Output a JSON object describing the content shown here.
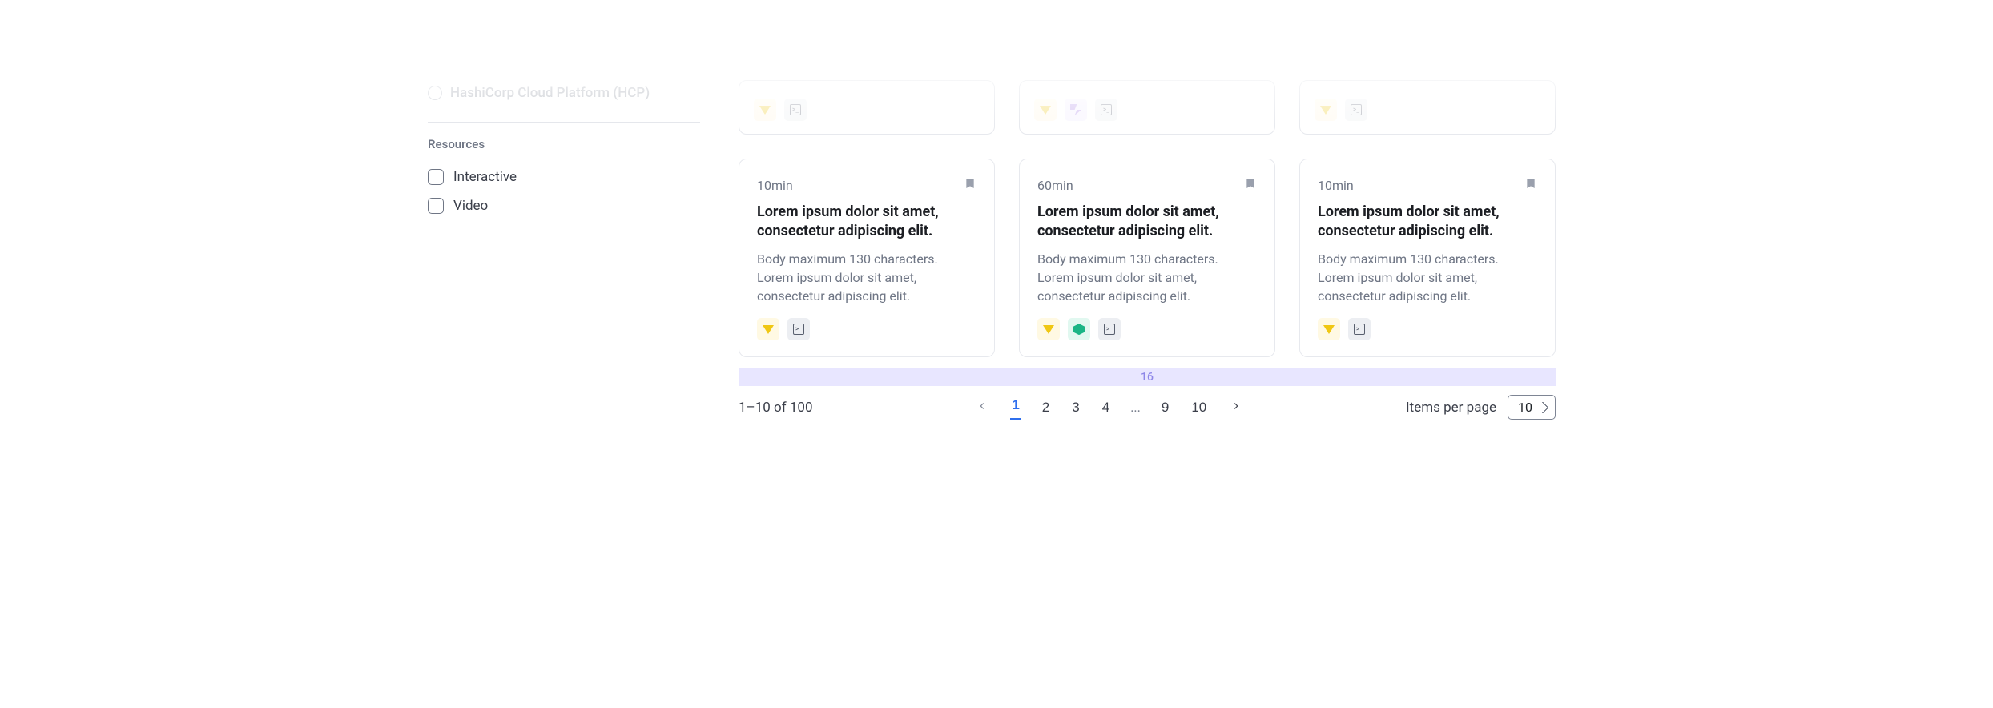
{
  "sidebar": {
    "disabled_radio": "HashiCorp Cloud Platform (HCP)",
    "resources_label": "Resources",
    "checks": [
      "Interactive",
      "Video"
    ]
  },
  "cards_row1": [
    {
      "badges": [
        "vault",
        "terminal"
      ]
    },
    {
      "badges": [
        "vault",
        "nomad",
        "terminal"
      ]
    },
    {
      "badges": [
        "vault",
        "terminal"
      ]
    }
  ],
  "cards_row2": [
    {
      "duration": "10min",
      "title": "Lorem ipsum dolor sit amet, consectetur adipiscing elit.",
      "body": "Body maximum 130 characters. Lorem ipsum dolor sit amet, consectetur adipiscing elit.",
      "badges": [
        "vault",
        "terminal"
      ]
    },
    {
      "duration": "60min",
      "title": "Lorem ipsum dolor sit amet, consectetur adipiscing elit.",
      "body": "Body maximum 130 characters. Lorem ipsum dolor sit amet, consectetur adipiscing elit.",
      "badges": [
        "vault",
        "consul",
        "terminal"
      ]
    },
    {
      "duration": "10min",
      "title": "Lorem ipsum dolor sit amet, consectetur adipiscing elit.",
      "body": "Body maximum 130 characters. Lorem ipsum dolor sit amet, consectetur adipiscing elit.",
      "badges": [
        "vault",
        "terminal"
      ]
    }
  ],
  "spacer_value": "16",
  "pagination": {
    "range": "1–10 of 100",
    "pages": [
      "1",
      "2",
      "3",
      "4",
      "...",
      "9",
      "10"
    ],
    "active": "1",
    "items_per_page_label": "Items per page",
    "items_per_page_value": "10"
  }
}
